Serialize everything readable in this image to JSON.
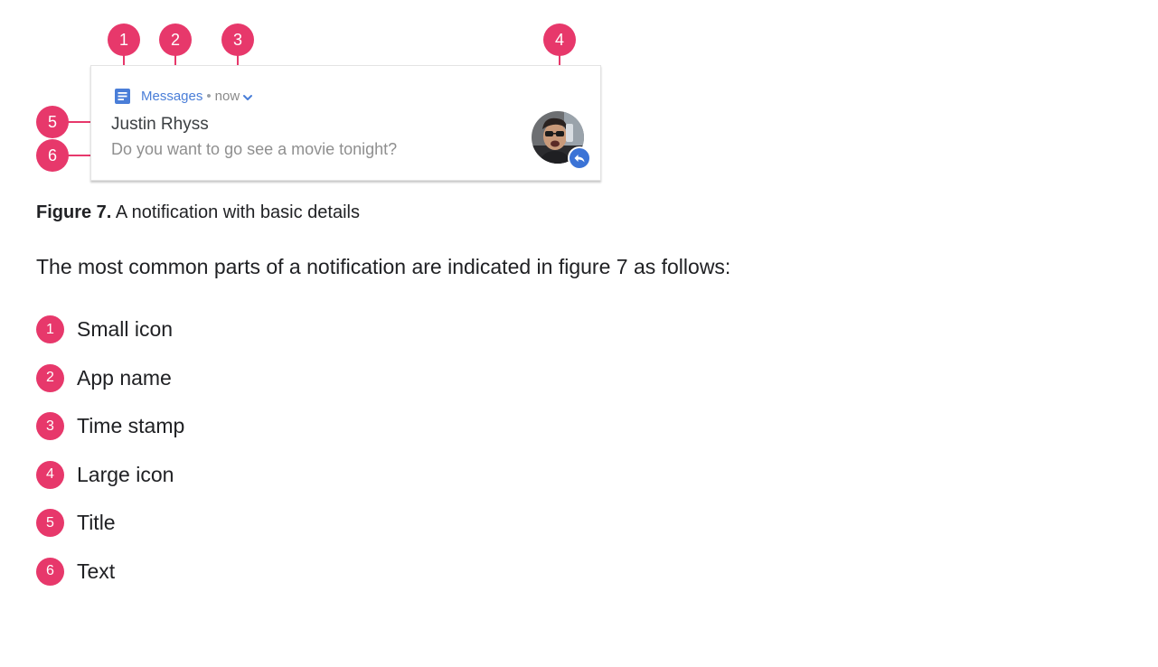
{
  "figure": {
    "notification": {
      "app_name": "Messages",
      "separator": "•",
      "timestamp": "now",
      "title": "Justin Rhyss",
      "text": "Do you want to go see a movie tonight?"
    },
    "callouts": [
      "1",
      "2",
      "3",
      "4",
      "5",
      "6"
    ],
    "icons": {
      "small_icon": "messages-app-icon",
      "expand": "chevron-down-icon",
      "large_icon": "contact-avatar",
      "reply": "reply-icon"
    },
    "colors": {
      "callout": "#e7386b",
      "app_name": "#4a7ed8",
      "reply_badge": "#3b73d6"
    }
  },
  "caption": {
    "label": "Figure 7.",
    "text": " A notification with basic details"
  },
  "intro": "The most common parts of a notification are indicated in figure 7 as follows:",
  "parts": [
    {
      "num": "1",
      "label": "Small icon"
    },
    {
      "num": "2",
      "label": "App name"
    },
    {
      "num": "3",
      "label": "Time stamp"
    },
    {
      "num": "4",
      "label": "Large icon"
    },
    {
      "num": "5",
      "label": "Title"
    },
    {
      "num": "6",
      "label": "Text"
    }
  ]
}
